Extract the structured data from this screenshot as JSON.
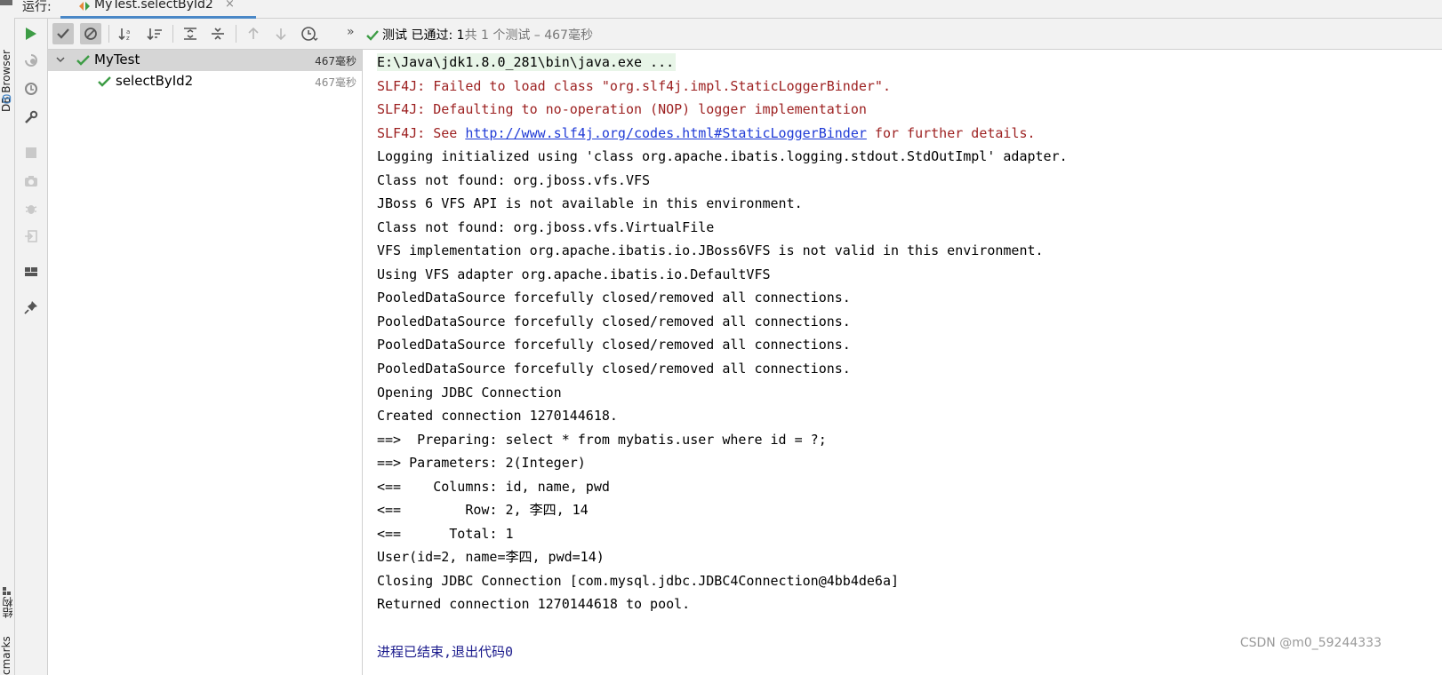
{
  "side_strip": {
    "db_browser_label": "DB Browser",
    "structure_label": "结构",
    "bookmarks_label": "cmarks"
  },
  "run_tab": {
    "run_label": "运行:",
    "tab_name": "MyTest.selectById2",
    "close_glyph": "×"
  },
  "toolbar": {
    "status_passed": "测试 已通过: 1",
    "status_rest": "共 1 个测试 – 467毫秒",
    "more_glyph": "»"
  },
  "tree": {
    "items": [
      {
        "name": "MyTest",
        "time": "467毫秒"
      },
      {
        "name": "selectById2",
        "time": "467毫秒"
      }
    ]
  },
  "console": {
    "cmd": "E:\\Java\\jdk1.8.0_281\\bin\\java.exe ...",
    "err1": "SLF4J: Failed to load class \"org.slf4j.impl.StaticLoggerBinder\".",
    "err2": "SLF4J: Defaulting to no-operation (NOP) logger implementation",
    "err3_pre": "SLF4J: See ",
    "err3_link": "http://www.slf4j.org/codes.html#StaticLoggerBinder",
    "err3_post": " for further details.",
    "lines": [
      "Logging initialized using 'class org.apache.ibatis.logging.stdout.StdOutImpl' adapter.",
      "Class not found: org.jboss.vfs.VFS",
      "JBoss 6 VFS API is not available in this environment.",
      "Class not found: org.jboss.vfs.VirtualFile",
      "VFS implementation org.apache.ibatis.io.JBoss6VFS is not valid in this environment.",
      "Using VFS adapter org.apache.ibatis.io.DefaultVFS",
      "PooledDataSource forcefully closed/removed all connections.",
      "PooledDataSource forcefully closed/removed all connections.",
      "PooledDataSource forcefully closed/removed all connections.",
      "PooledDataSource forcefully closed/removed all connections.",
      "Opening JDBC Connection",
      "Created connection 1270144618.",
      "==>  Preparing: select * from mybatis.user where id = ?;",
      "==> Parameters: 2(Integer)",
      "<==    Columns: id, name, pwd",
      "<==        Row: 2, 李四, 14",
      "<==      Total: 1",
      "User(id=2, name=李四, pwd=14)",
      "Closing JDBC Connection [com.mysql.jdbc.JDBC4Connection@4bb4de6a]",
      "Returned connection 1270144618 to pool."
    ],
    "exit_line": "进程已结束,退出代码0"
  },
  "watermark": "CSDN @m0_59244333",
  "colors": {
    "pass_green": "#3d9c45",
    "error_red": "#9c1f1f",
    "link_blue": "#1f3ad6",
    "tab_underline": "#4a88c7"
  }
}
